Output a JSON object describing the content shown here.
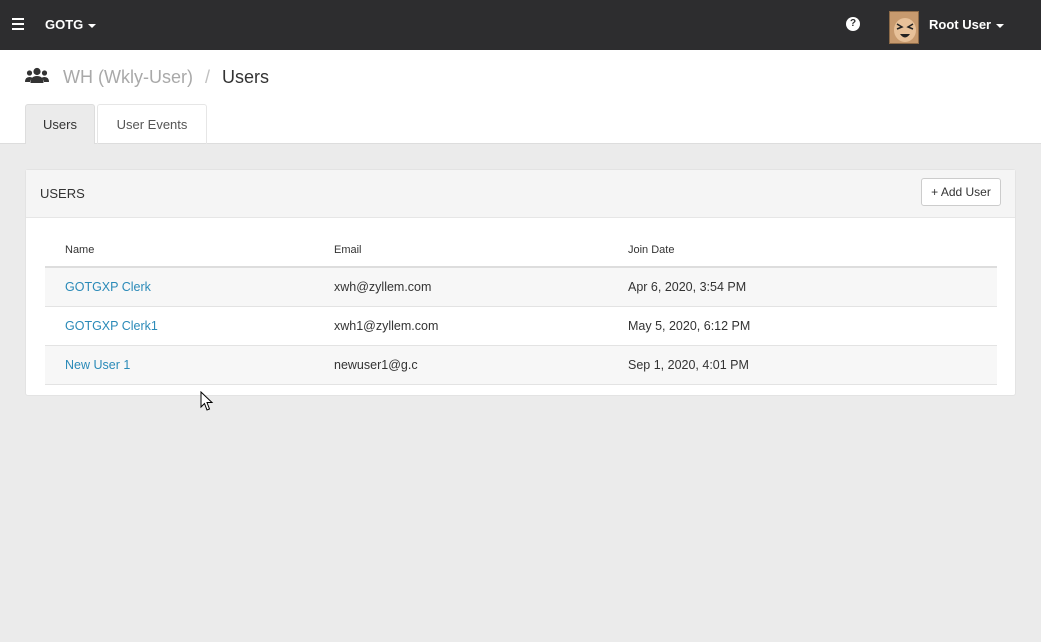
{
  "topbar": {
    "brand": "GOTG",
    "help_icon": "question-circle-icon",
    "user": "Root User"
  },
  "breadcrumb": {
    "parent": "WH (Wkly-User)",
    "separator": "/",
    "current": "Users"
  },
  "tabs": [
    {
      "label": "Users",
      "active": true
    },
    {
      "label": "User Events",
      "active": false
    }
  ],
  "panel": {
    "title": "USERS",
    "add_button": "+ Add User"
  },
  "table": {
    "columns": [
      "Name",
      "Email",
      "Join Date"
    ],
    "rows": [
      {
        "name": "GOTGXP Clerk",
        "email": "xwh@zyllem.com",
        "join_date": "Apr 6, 2020, 3:54 PM"
      },
      {
        "name": "GOTGXP Clerk1",
        "email": "xwh1@zyllem.com",
        "join_date": "May 5, 2020, 6:12 PM"
      },
      {
        "name": "New User 1",
        "email": "newuser1@g.c",
        "join_date": "Sep 1, 2020, 4:01 PM"
      }
    ]
  },
  "colors": {
    "topbar": "#2d2d2f",
    "link": "#2a8ab8",
    "background": "#ebebeb"
  }
}
